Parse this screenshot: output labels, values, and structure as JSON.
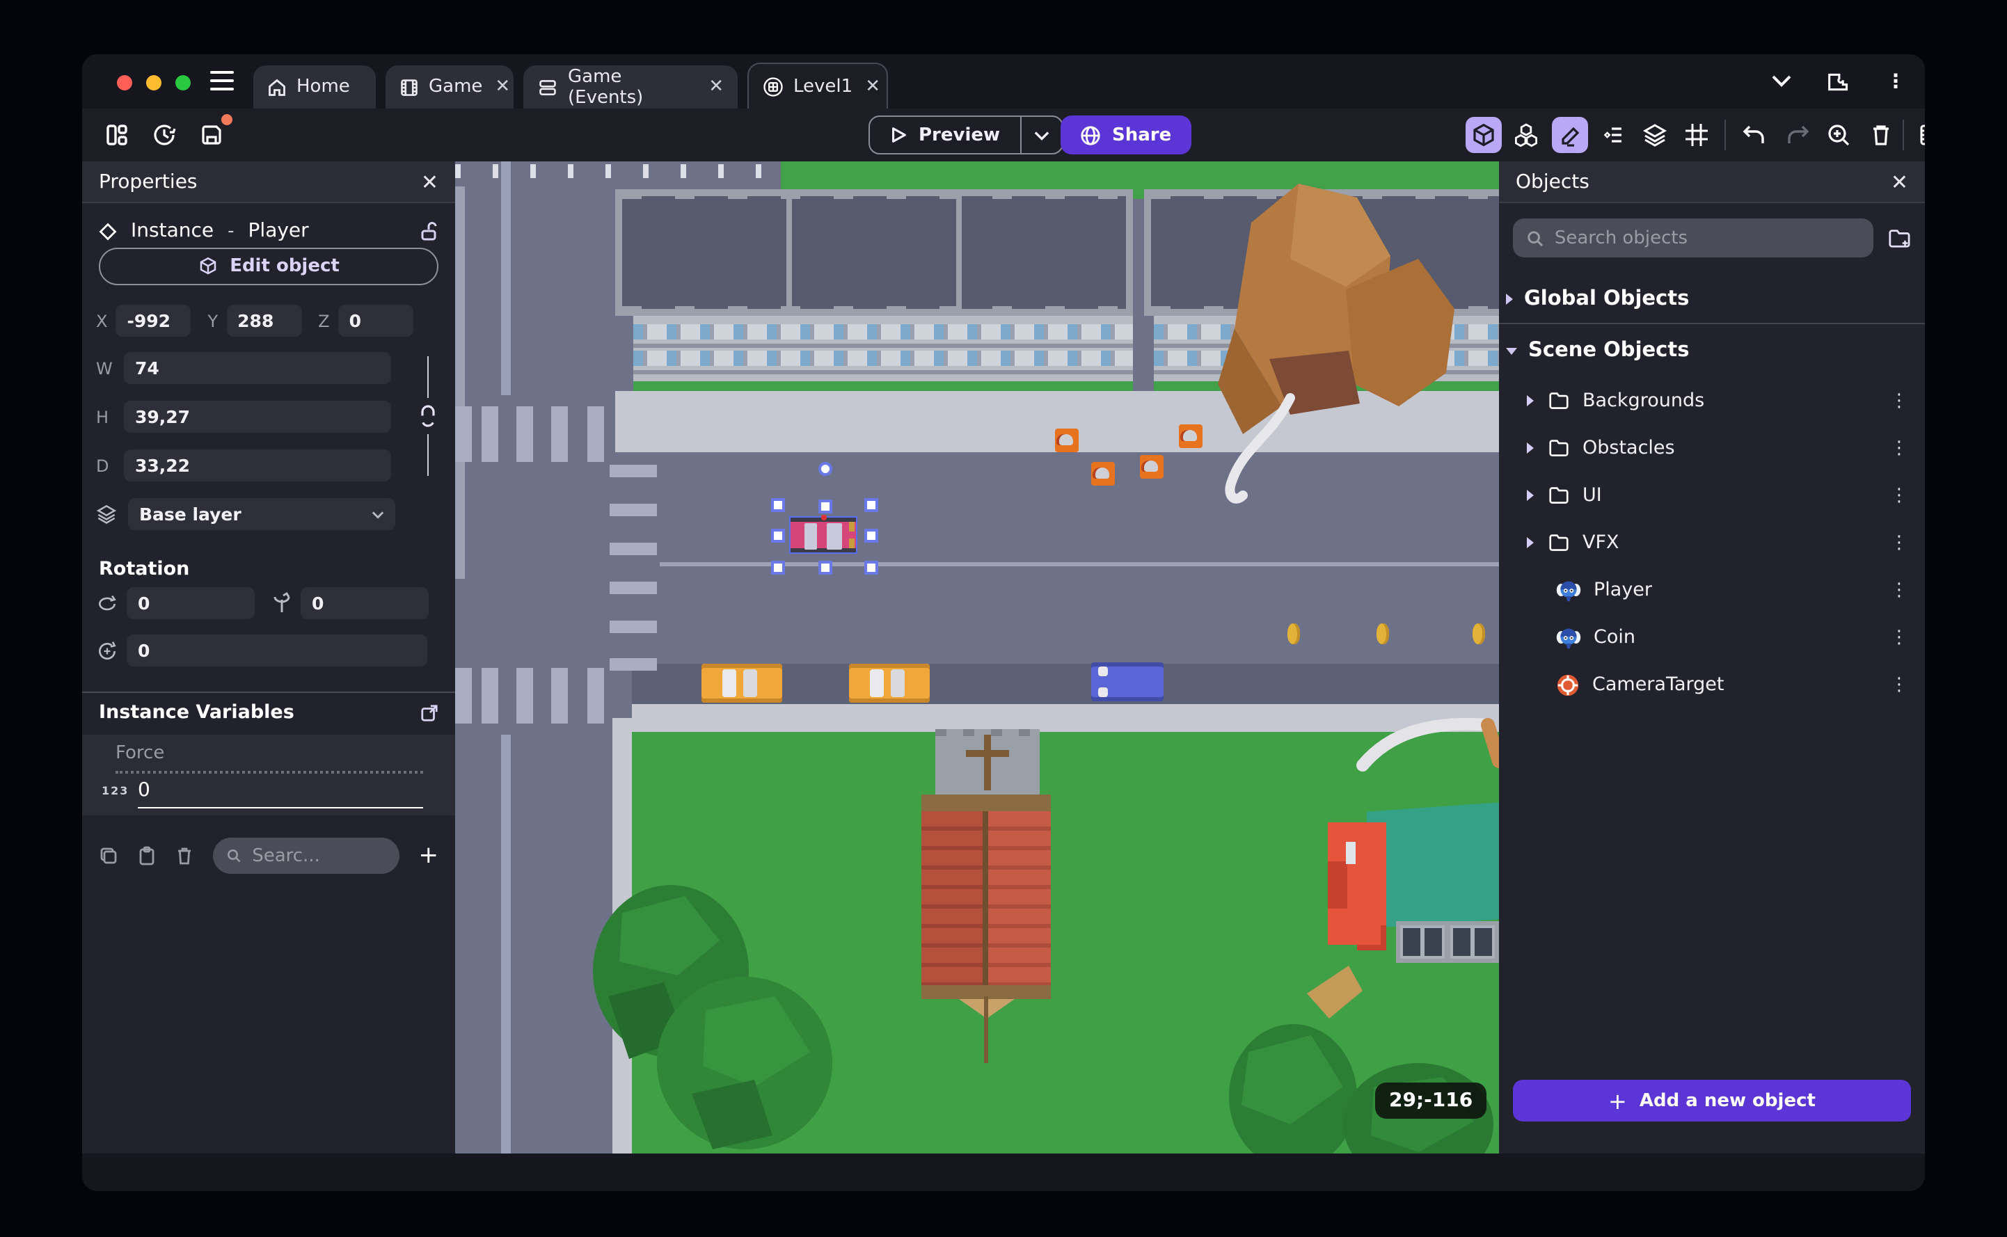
{
  "titlebar": {
    "tabs": [
      {
        "label": "Home",
        "closable": false
      },
      {
        "label": "Game",
        "closable": true
      },
      {
        "label": "Game (Events)",
        "closable": true
      },
      {
        "label": "Level1",
        "closable": true
      }
    ],
    "close_glyph": "✕"
  },
  "toolbar": {
    "preview_label": "Preview",
    "share_label": "Share"
  },
  "properties_panel": {
    "title": "Properties",
    "close_glyph": "✕",
    "instance_type": "Instance",
    "separator": "-",
    "instance_name": "Player",
    "edit_object_label": "Edit object",
    "coords": {
      "x_label": "X",
      "x": "-992",
      "y_label": "Y",
      "y": "288",
      "z_label": "Z",
      "z": "0"
    },
    "size": {
      "w_label": "W",
      "w": "74",
      "h_label": "H",
      "h": "39,27",
      "d_label": "D",
      "d": "33,22"
    },
    "layer_value": "Base layer",
    "rotation": {
      "title": "Rotation",
      "rx": "0",
      "ry": "0",
      "rz": "0"
    },
    "variables": {
      "title": "Instance Variables",
      "rows": [
        {
          "name": "Force",
          "type_badge": "123",
          "value": "0"
        }
      ],
      "search_placeholder": "Searc...",
      "add_glyph": "+"
    }
  },
  "objects_panel": {
    "title": "Objects",
    "close_glyph": "✕",
    "search_placeholder": "Search objects",
    "sections": [
      {
        "label": "Global Objects"
      },
      {
        "label": "Scene Objects"
      }
    ],
    "items": [
      {
        "label": "Backgrounds",
        "kind": "folder"
      },
      {
        "label": "Obstacles",
        "kind": "folder"
      },
      {
        "label": "UI",
        "kind": "folder"
      },
      {
        "label": "VFX",
        "kind": "folder"
      },
      {
        "label": "Player",
        "kind": "object"
      },
      {
        "label": "Coin",
        "kind": "object"
      },
      {
        "label": "CameraTarget",
        "kind": "object"
      }
    ],
    "kebab_glyph": "⋮",
    "add_button_label": "Add a new object",
    "add_button_plus": "+"
  },
  "scene": {
    "coords_badge": "29;-116",
    "selected_object": "Player car instance"
  },
  "colors": {
    "accent_purple": "#5b35d5",
    "toolbar_active": "#b9a8f5",
    "selection_blue": "#6a78e8",
    "unsaved_dot": "#f07a5a",
    "traffic_red": "#ff5f57",
    "traffic_yellow": "#febc2e",
    "traffic_green": "#28c840"
  }
}
